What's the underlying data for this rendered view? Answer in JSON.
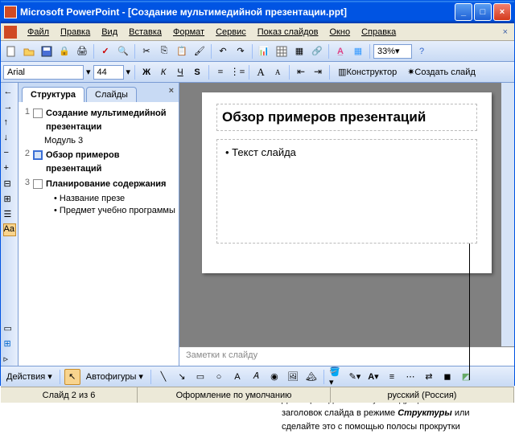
{
  "window": {
    "title": "Microsoft PowerPoint - [Создание мультимедийной презентации.ppt]"
  },
  "menu": {
    "file": "Файл",
    "edit": "Правка",
    "view": "Вид",
    "insert": "Вставка",
    "format": "Формат",
    "tools": "Сервис",
    "show": "Показ слайдов",
    "window": "Окно",
    "help": "Справка"
  },
  "toolbar": {
    "zoom": "33%"
  },
  "fontbar": {
    "fontname": "Arial",
    "fontsize": "44",
    "designer": "Конструктор",
    "newslide": "Создать слайд"
  },
  "tabs": {
    "outline": "Структура",
    "slides": "Слайды"
  },
  "outline": {
    "n1": "1",
    "t1": "Создание мультимедийной презентации",
    "s1": "Модуль 3",
    "n2": "2",
    "t2": "Обзор примеров презентаций",
    "n3": "3",
    "t3": "Планирование содержания",
    "b1": "Название презе",
    "b2": "Предмет учебно программы"
  },
  "slide": {
    "title": "Обзор примеров презентаций",
    "bullet": "• Текст слайда"
  },
  "notes": "Заметки к слайду",
  "drawbar": {
    "actions": "Действия",
    "autoshapes": "Автофигуры"
  },
  "status": {
    "slide": "Слайд 2 из 6",
    "design": "Оформление по умолчанию",
    "lang": "русский (Россия)"
  },
  "caption": {
    "l1": "Для перехода к новому слайду щелкните",
    "l2_a": "заголовок слайда в режиме ",
    "l2_b": "Структуры",
    "l2_c": " или",
    "l3": "сделайте это с помощью полосы прокрутки"
  }
}
